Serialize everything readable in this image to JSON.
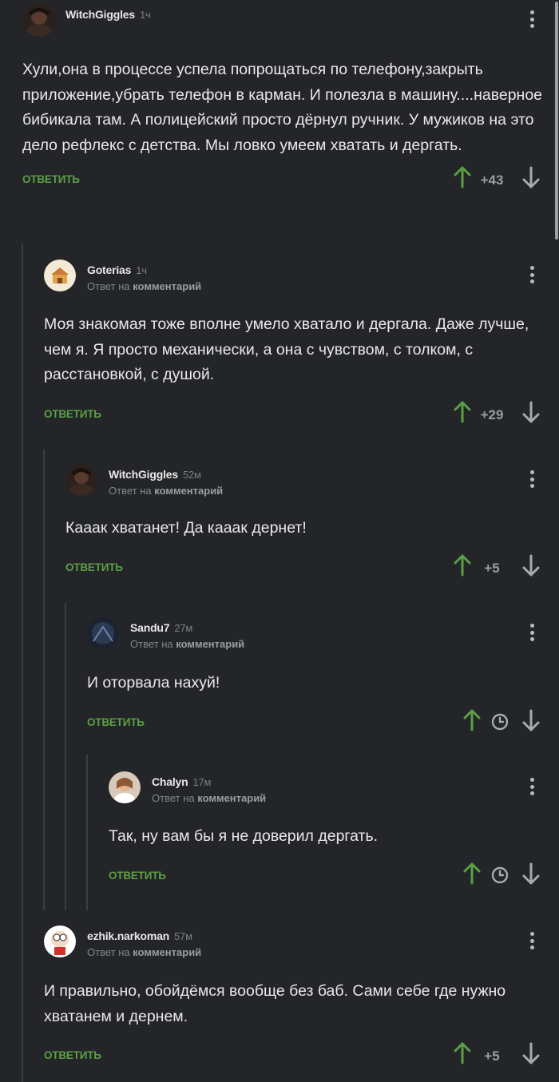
{
  "labels": {
    "reply_to": "Ответ на",
    "reply_to_target": "комментарий",
    "reply_button": "ОТВЕТИТЬ"
  },
  "comments": [
    {
      "author": "WitchGiggles",
      "time": "1ч",
      "text": "Хули,она в процессе успела попрощаться по телефону,закрыть приложение,убрать телефон в карман. И полезла в машину....наверное бибикала там. А полицейский просто дёрнул ручник. У мужиков на это дело рефлекс с детства. Мы ловко умеем хватать и дергать.",
      "score": "+43"
    },
    {
      "author": "Goterias",
      "time": "1ч",
      "text": "Моя знакомая тоже вполне умело хватало и дергала. Даже лучше, чем я. Я просто механически, а она с чувством, с толком, с расстановкой, с душой.",
      "score": "+29"
    },
    {
      "author": "WitchGiggles",
      "time": "52м",
      "text": "Кааак хватанет! Да кааак дернет!",
      "score": "+5"
    },
    {
      "author": "Sandu7",
      "time": "27м",
      "text": "И оторвала нахуй!",
      "score": "",
      "score_hidden_icon": "clock-icon"
    },
    {
      "author": "Chalyn",
      "time": "17м",
      "text": "Так, ну вам бы я не доверил дергать.",
      "score": "",
      "score_hidden_icon": "clock-icon"
    },
    {
      "author": "ezhik.narkoman",
      "time": "57м",
      "text": "И правильно, обойдёмся вообще без баб. Сами себе где нужно хватанем и дернем.",
      "score": "+5"
    }
  ],
  "colors": {
    "background": "#232528",
    "accent_green": "#5c9f45",
    "text": "#e9e9e9",
    "muted": "#83868b"
  }
}
